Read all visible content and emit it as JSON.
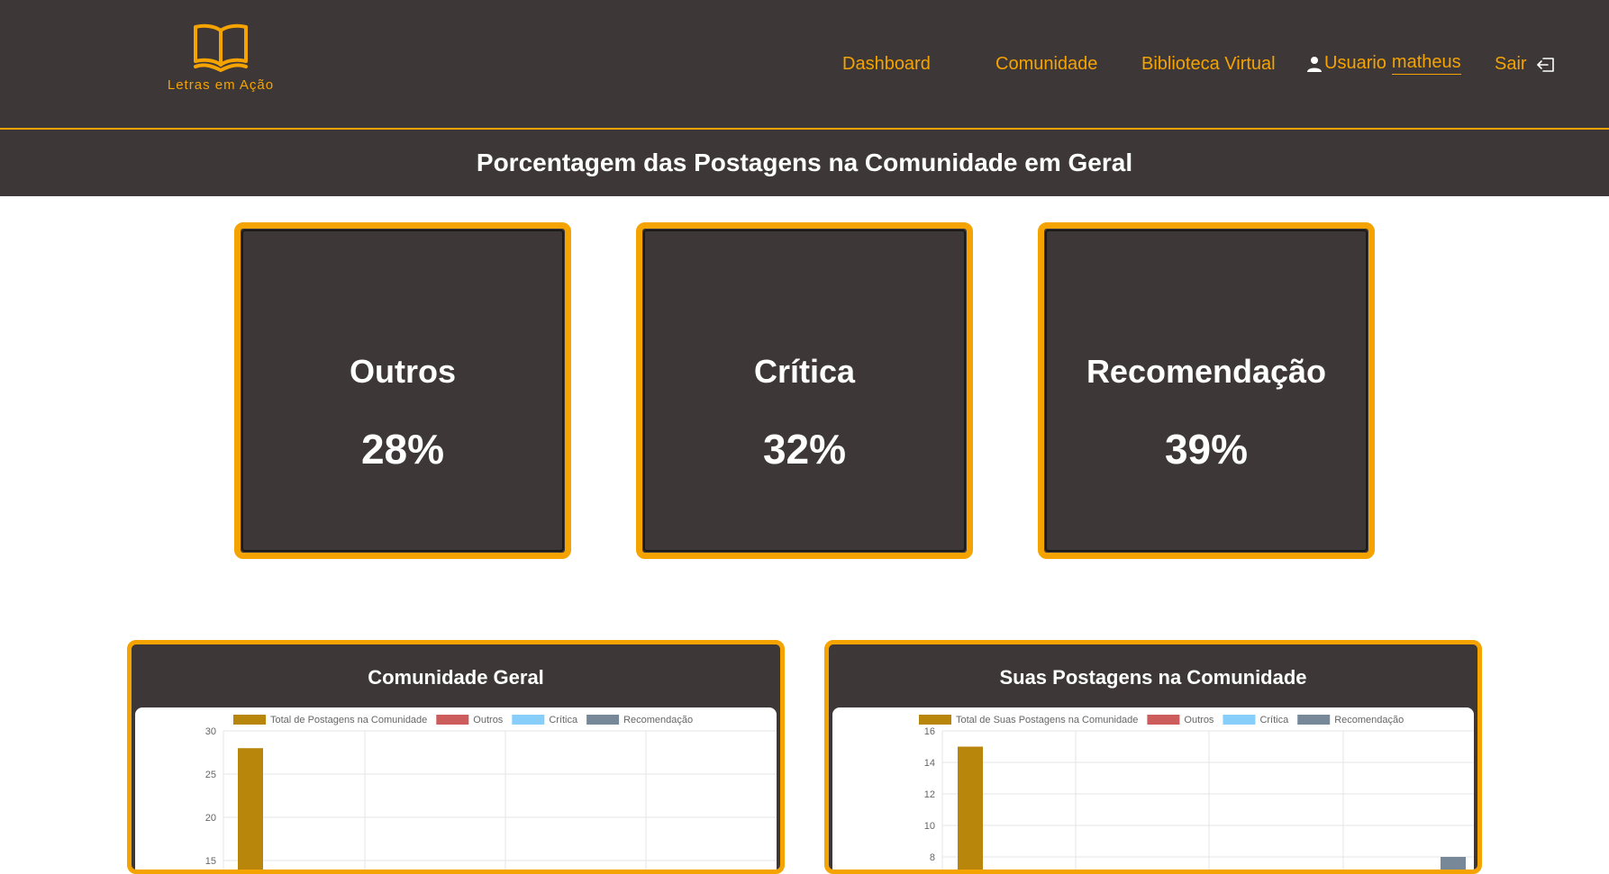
{
  "app": {
    "logo_text": "Letras em Ação"
  },
  "nav": {
    "dashboard": "Dashboard",
    "comunidade": "Comunidade",
    "biblioteca": "Biblioteca Virtual",
    "user_prefix": "Usuario",
    "user_name": "matheus",
    "sair": "Sair"
  },
  "banner": {
    "title": "Porcentagem das Postagens na Comunidade em Geral"
  },
  "stats": [
    {
      "label": "Outros",
      "value": "28%"
    },
    {
      "label": "Crítica",
      "value": "32%"
    },
    {
      "label": "Recomendação",
      "value": "39%"
    }
  ],
  "colors": {
    "brand": "#f5a300",
    "dark_bg": "#3d3837",
    "total": "#b8860b",
    "outros": "#cd5c5c",
    "critica": "#87cefa",
    "recomendacao": "#778899"
  },
  "chart_data": [
    {
      "type": "bar",
      "title": "Comunidade Geral",
      "y_ticks": [
        "30",
        "25",
        "20",
        "15"
      ],
      "ylim": [
        15,
        30
      ],
      "series": [
        {
          "name": "Total de Postagens na Comunidade",
          "values": [
            28
          ]
        },
        {
          "name": "Outros",
          "values": []
        },
        {
          "name": "Crítica",
          "values": []
        },
        {
          "name": "Recomendação",
          "values": []
        }
      ]
    },
    {
      "type": "bar",
      "title": "Suas Postagens na Comunidade",
      "y_ticks": [
        "16",
        "14",
        "12",
        "10",
        "8"
      ],
      "ylim": [
        8,
        16
      ],
      "series": [
        {
          "name": "Total de Suas Postagens na Comunidade",
          "values": [
            15
          ]
        },
        {
          "name": "Outros",
          "values": []
        },
        {
          "name": "Crítica",
          "values": []
        },
        {
          "name": "Recomendação",
          "values": [
            8
          ]
        }
      ]
    }
  ]
}
